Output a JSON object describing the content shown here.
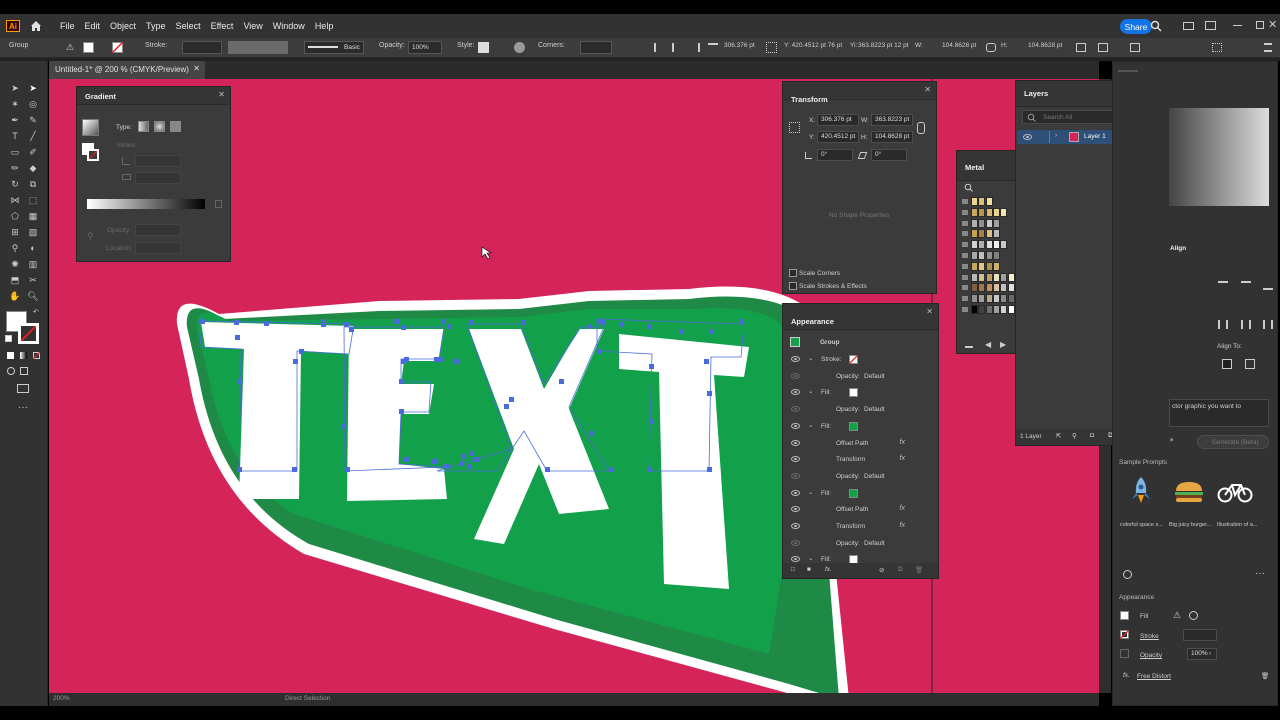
{
  "app": {
    "logo": "Ai",
    "menus": [
      "File",
      "Edit",
      "Object",
      "Type",
      "Select",
      "Effect",
      "View",
      "Window",
      "Help"
    ],
    "share_label": "Share"
  },
  "control_bar": {
    "selection": "Group",
    "stroke_label": "Stroke:",
    "brush_label": "Basic",
    "opacity_label": "Opacity:",
    "opacity_value": "100%",
    "style_label": "Style:",
    "corners_label": "Corners:",
    "x_label": "X:",
    "x_value": "306.376 pt",
    "y_value": "420.4512 pt",
    "y_combined": "Y: 420.4512 pt 76 pt",
    "yi_value": "363.8223 pt 12 pt",
    "w_value": "104.8628 pt",
    "h_value": "104.8628 pt",
    "yi_label": "Yi:",
    "w_label": "W:",
    "h_label": "H:"
  },
  "document": {
    "tab_title": "Untitled-1* @ 200 % (CMYK/Preview)",
    "artwork_text": "TEXT",
    "status": "Direct Selection",
    "zoom": "200%"
  },
  "gradient_panel": {
    "title": "Gradient",
    "type_label": "Type:",
    "stroke_label": "Stroke:",
    "opacity_label": "Opacity:",
    "location_label": "Location:"
  },
  "transform_panel": {
    "title": "Transform",
    "x_label": "X:",
    "x": "306.376 pt",
    "y_label": "Y:",
    "y": "420.4512 pt",
    "w_label": "W:",
    "w": "363.8223 pt",
    "h_label": "H:",
    "h": "104.8628 pt",
    "angle": "0°",
    "shear": "0°",
    "no_shape": "No Shape Properties",
    "scale_corners": "Scale Corners",
    "scale_strokes": "Scale Strokes & Effects"
  },
  "metal_panel": {
    "title": "Metal"
  },
  "layers_panel": {
    "title": "Layers",
    "search_placeholder": "Search All",
    "layer_name": "Layer 1",
    "footer": "1 Layer"
  },
  "appearance_panel": {
    "title": "Appearance",
    "group_label": "Group",
    "rows": [
      {
        "label": "Stroke:",
        "type": "stroke"
      },
      {
        "label": "Opacity:",
        "value": "Default",
        "sub": true
      },
      {
        "label": "Fill:",
        "type": "fill-white"
      },
      {
        "label": "Opacity:",
        "value": "Default",
        "sub": true
      },
      {
        "label": "Fill:",
        "type": "fill-green"
      },
      {
        "label": "Offset Path",
        "fx": true,
        "sub": true
      },
      {
        "label": "Transform",
        "fx": true,
        "sub": true
      },
      {
        "label": "Opacity:",
        "value": "Default",
        "sub": true
      },
      {
        "label": "Fill:",
        "type": "fill-green"
      },
      {
        "label": "Offset Path",
        "fx": true,
        "sub": true
      },
      {
        "label": "Transform",
        "fx": true,
        "sub": true
      },
      {
        "label": "Opacity:",
        "value": "Default",
        "sub": true
      },
      {
        "label": "Fill:",
        "type": "fill-white"
      }
    ]
  },
  "right_panel": {
    "align_title": "Align",
    "align_to": "Align To:",
    "prompt_text": "ctor graphic you want to",
    "generate": "Generate (Beta)",
    "sample_prompts_title": "Sample Prompts",
    "samples": [
      "colorful space s...",
      "Big juicy burger...",
      "Illustration of a..."
    ],
    "appearance_title": "Appearance",
    "fill_label": "Fill",
    "stroke_label": "Stroke",
    "opacity_label": "Opacity",
    "opacity_value": "100%",
    "effect": "Free Distort",
    "fx_label": "fx."
  },
  "colors": {
    "canvas": "#d4245a",
    "green_dark": "#1f8a45",
    "green": "#12a04b",
    "white": "#ffffff",
    "anchor": "#4a6bdc",
    "share": "#1473e6"
  },
  "metal_swatches": [
    [
      "#e8d48a",
      "#d8c070",
      "#f0e0a0"
    ],
    [
      "#c8a860",
      "#b89850",
      "#d8b870",
      "#e8d490",
      "#f0e4b0"
    ],
    [
      "#b0b0b0",
      "#909090",
      "#c8c8c8",
      "#a0a0a0"
    ],
    [
      "#c8a050",
      "#a88040",
      "#d8c080",
      "#b8b8b8"
    ],
    [
      "#d0d0d0",
      "#b0b0b0",
      "#e0e0e0",
      "#f0f0f0",
      "#c8c8c8"
    ],
    [
      "#a8a8a8",
      "#c0c0c0",
      "#909090",
      "#808080"
    ],
    [
      "#c8a860",
      "#e0c880",
      "#b09050",
      "#d0b070"
    ],
    [
      "#b8b8b8",
      "#d0c090",
      "#c0a060",
      "#e8e0c0",
      "#a0a0a0",
      "#f8f0d0"
    ],
    [
      "#806040",
      "#a07850",
      "#c09060",
      "#d8c0a0",
      "#c0c0c0",
      "#e0e0e0"
    ],
    [
      "#909090",
      "#a0a0a0",
      "#b8a890",
      "#c8c8c8",
      "#8a8a8a",
      "#6a6a6a"
    ],
    [
      "#000000",
      "#404040",
      "#707070",
      "#a0a0a0",
      "#d0d0d0",
      "#ffffff"
    ]
  ]
}
